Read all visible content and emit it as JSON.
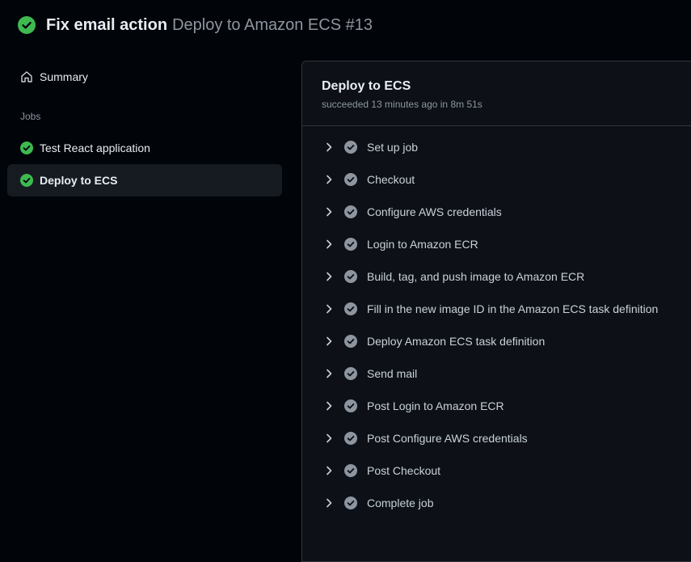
{
  "header": {
    "title_strong": "Fix email action",
    "title_rest": "Deploy to Amazon ECS #13",
    "status_icon": "success-check-icon",
    "status_color": "#3fb950"
  },
  "sidebar": {
    "summary_label": "Summary",
    "jobs_heading": "Jobs",
    "jobs": [
      {
        "label": "Test React application",
        "active": false
      },
      {
        "label": "Deploy to ECS",
        "active": true
      }
    ]
  },
  "job": {
    "title": "Deploy to ECS",
    "subtitle": "succeeded 13 minutes ago in 8m 51s",
    "steps": [
      {
        "label": "Set up job"
      },
      {
        "label": "Checkout"
      },
      {
        "label": "Configure AWS credentials"
      },
      {
        "label": "Login to Amazon ECR"
      },
      {
        "label": "Build, tag, and push image to Amazon ECR"
      },
      {
        "label": "Fill in the new image ID in the Amazon ECS task definition"
      },
      {
        "label": "Deploy Amazon ECS task definition"
      },
      {
        "label": "Send mail"
      },
      {
        "label": "Post Login to Amazon ECR"
      },
      {
        "label": "Post Configure AWS credentials"
      },
      {
        "label": "Post Checkout"
      },
      {
        "label": "Complete job"
      }
    ]
  },
  "colors": {
    "success": "#3fb950",
    "step_check": "#8d96a0"
  }
}
